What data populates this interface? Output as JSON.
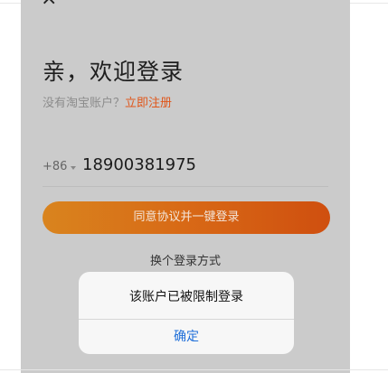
{
  "screen": {
    "close_icon": "×",
    "title": "亲，欢迎登录",
    "no_account_text": "没有淘宝账户？",
    "register_link": "立即注册",
    "phone": {
      "country_code": "+86",
      "number": "18900381975"
    },
    "login_button": "同意协议并一键登录",
    "alt_login": "换个登录方式"
  },
  "dialog": {
    "message": "该账户已被限制登录",
    "confirm": "确定"
  },
  "colors": {
    "accent": "#d86916",
    "link": "#e0561a",
    "dialog_button": "#1f6fd9",
    "overlay": "#cbcbcb"
  }
}
